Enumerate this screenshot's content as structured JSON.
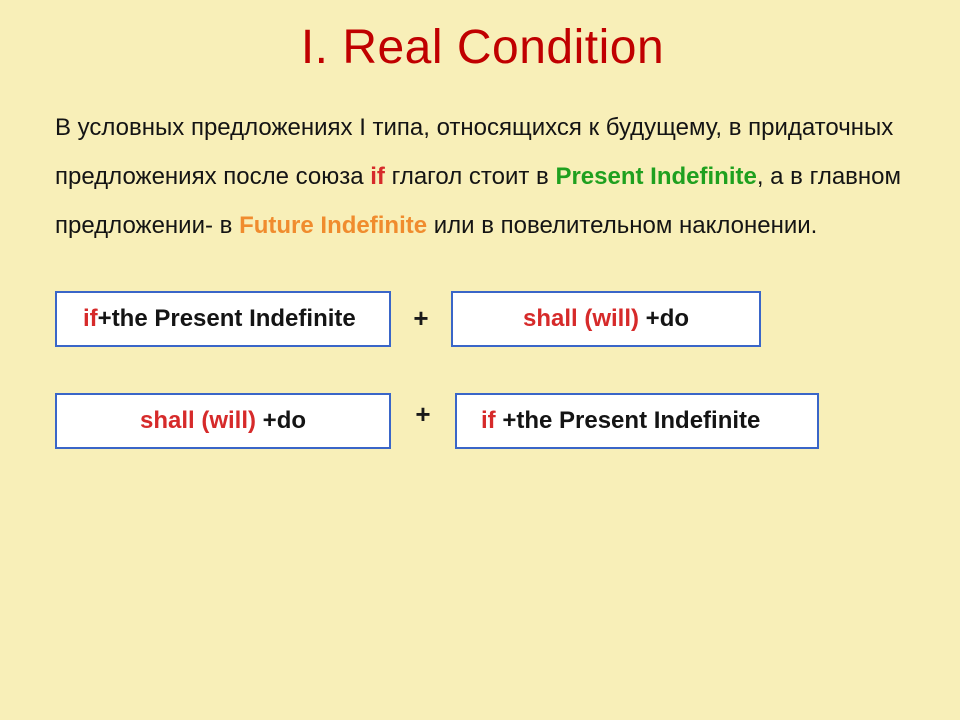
{
  "title": "I. Real Condition",
  "paragraph": {
    "t1": "В условных предложениях I типа, относящихся к будущему, в придаточных предложениях после союза ",
    "kw_if": "if",
    "t2": "  глагол стоит в ",
    "kw_present": "Present Indefinite",
    "t3": ", а в главном предложении- в ",
    "kw_future": "Future Indefinite",
    "t4": " или в повелительном наклонении."
  },
  "boxes": {
    "row1_left": {
      "if": "if",
      "rest": "+the Present Indefinite"
    },
    "row1_right": {
      "main": "shall  (will) ",
      "rest": "+do"
    },
    "row2_left": {
      "main": "shall  (will) ",
      "rest": "+do"
    },
    "row2_right": {
      "if": "if ",
      "rest": "+the Present Indefinite"
    },
    "plus": "+"
  }
}
